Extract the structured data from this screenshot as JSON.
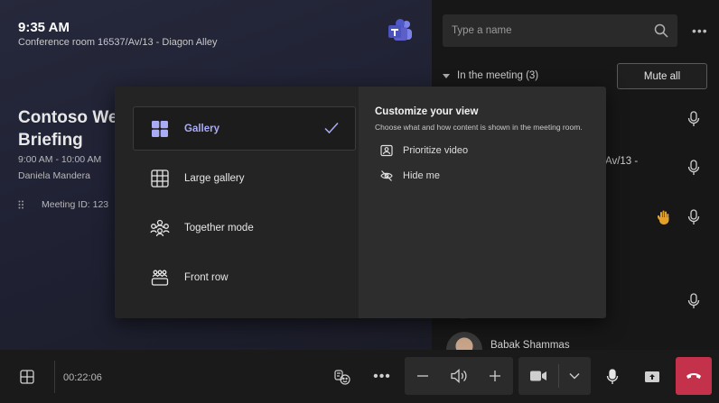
{
  "header": {
    "clock": "9:35 AM",
    "room": "Conference room 16537/Av/13 - Diagon Alley"
  },
  "meeting": {
    "title": "Contoso We Briefing",
    "time": "9:00 AM - 10:00 AM",
    "organizer": "Daniela Mandera",
    "meeting_id": "Meeting ID: 123"
  },
  "roster": {
    "search_placeholder": "Type a name",
    "section_label": "In the meeting (3)",
    "mute_all_label": "Mute all",
    "room_fragment": "Av/13 -",
    "participant_name": "Babak Shammas"
  },
  "layouts": {
    "items": [
      {
        "label": "Gallery",
        "icon": "gallery-icon",
        "selected": true
      },
      {
        "label": "Large gallery",
        "icon": "large-gallery-icon",
        "selected": false
      },
      {
        "label": "Together mode",
        "icon": "together-mode-icon",
        "selected": false
      },
      {
        "label": "Front row",
        "icon": "front-row-icon",
        "selected": false
      }
    ]
  },
  "customize": {
    "title": "Customize your view",
    "description": "Choose what and how content is shown in the meeting room.",
    "options": [
      {
        "label": "Prioritize video",
        "icon": "prioritize-video-icon"
      },
      {
        "label": "Hide me",
        "icon": "hide-me-icon"
      }
    ]
  },
  "controls": {
    "duration": "00:22:06"
  },
  "colors": {
    "accent": "#a9acf5",
    "hangup": "#c4314b",
    "raise_hand": "#e3a12b"
  }
}
